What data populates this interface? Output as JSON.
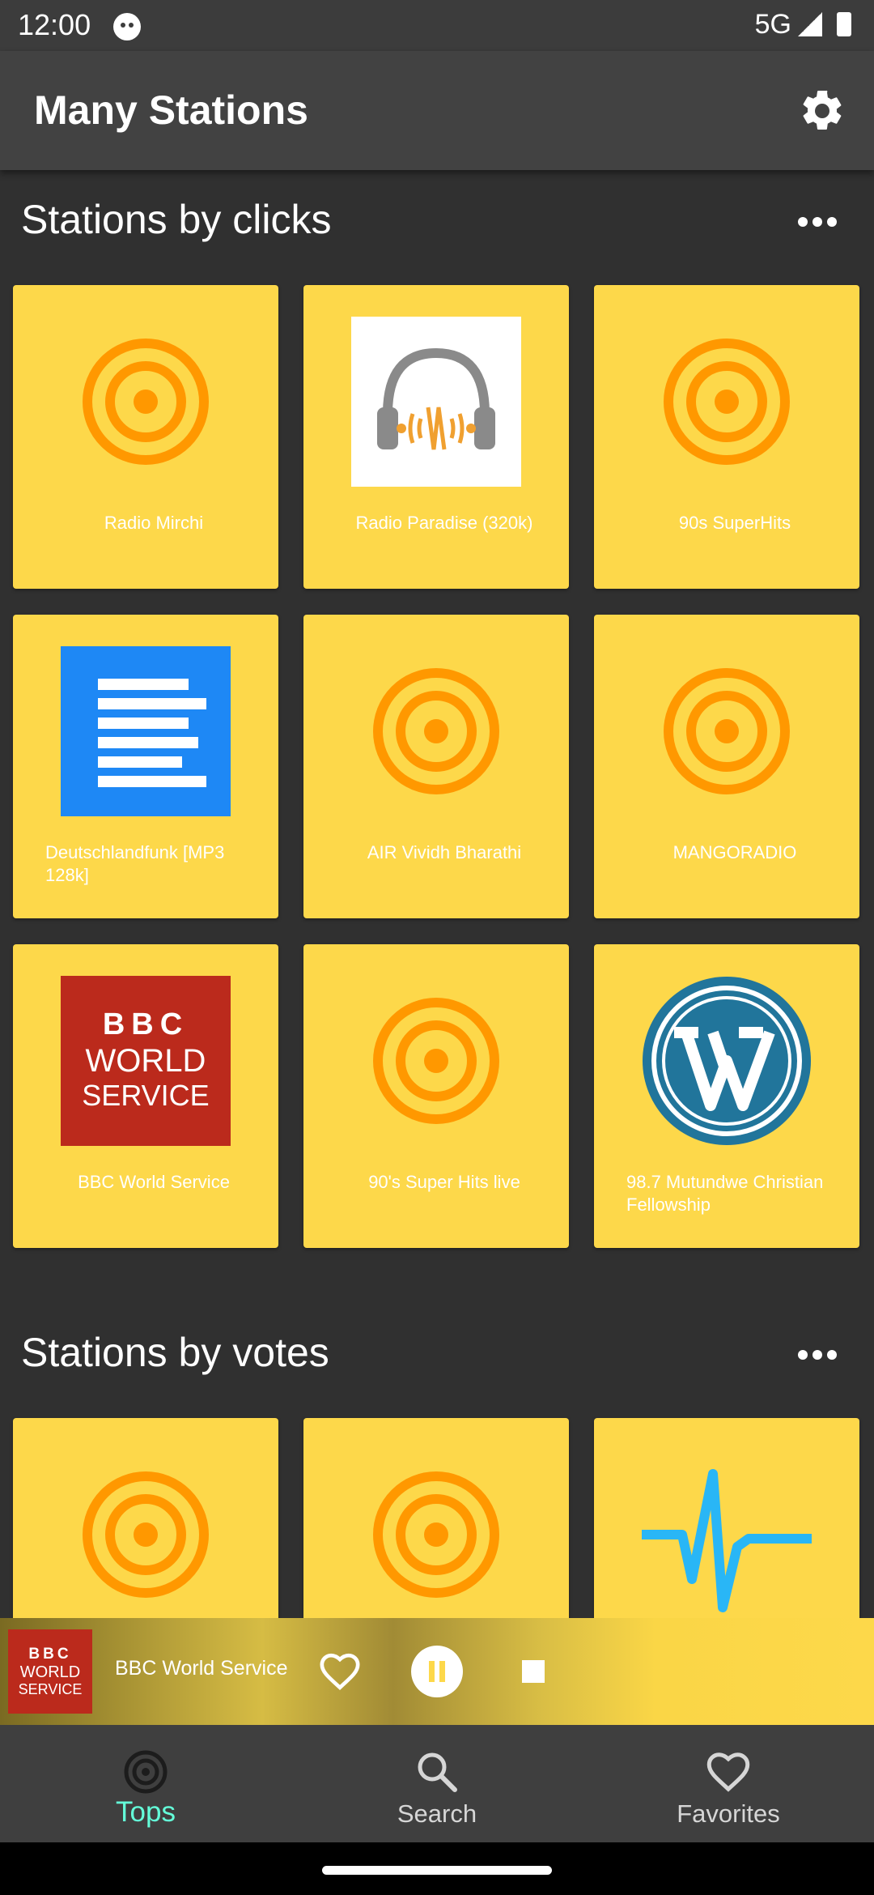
{
  "status_bar": {
    "time": "12:00",
    "network": "5G"
  },
  "app_bar": {
    "title": "Many Stations",
    "settings_icon": "gear-icon"
  },
  "sections": [
    {
      "title": "Stations by clicks",
      "stations": [
        {
          "name": "Radio Mirchi",
          "icon": "radio-placeholder-icon"
        },
        {
          "name": "Radio Paradise (320k)",
          "icon": "headphones-logo"
        },
        {
          "name": "90s SuperHits",
          "icon": "radio-placeholder-icon"
        },
        {
          "name": "Deutschlandfunk [MP3 128k]",
          "icon": "document-lines-logo"
        },
        {
          "name": "AIR Vividh Bharathi",
          "icon": "radio-placeholder-icon"
        },
        {
          "name": "MANGORADIO",
          "icon": "radio-placeholder-icon"
        },
        {
          "name": "BBC World Service",
          "icon": "bbc-world-service-logo",
          "logo_lines": [
            "BBC",
            "WORLD",
            "SERVICE"
          ]
        },
        {
          "name": "90's Super Hits live",
          "icon": "radio-placeholder-icon"
        },
        {
          "name": "98.7 Mutundwe Christian Fellowship",
          "icon": "wordpress-logo"
        }
      ]
    },
    {
      "title": "Stations by votes",
      "stations": [
        {
          "name": "",
          "icon": "radio-placeholder-icon"
        },
        {
          "name": "",
          "icon": "radio-placeholder-icon"
        },
        {
          "name": "",
          "icon": "waveform-logo"
        }
      ]
    }
  ],
  "player": {
    "station": "BBC World Service",
    "art_lines": [
      "BBC",
      "WORLD",
      "SERVICE"
    ]
  },
  "bottom_nav": [
    {
      "label": "Tops",
      "icon": "radio-icon",
      "active": true
    },
    {
      "label": "Search",
      "icon": "search-icon",
      "active": false
    },
    {
      "label": "Favorites",
      "icon": "heart-icon",
      "active": false
    }
  ],
  "colors": {
    "tile_background": "#fdd84a",
    "placeholder_orange": "#ff9800",
    "active_nav": "#64ffda",
    "background": "#303030",
    "app_bar": "#424242"
  }
}
